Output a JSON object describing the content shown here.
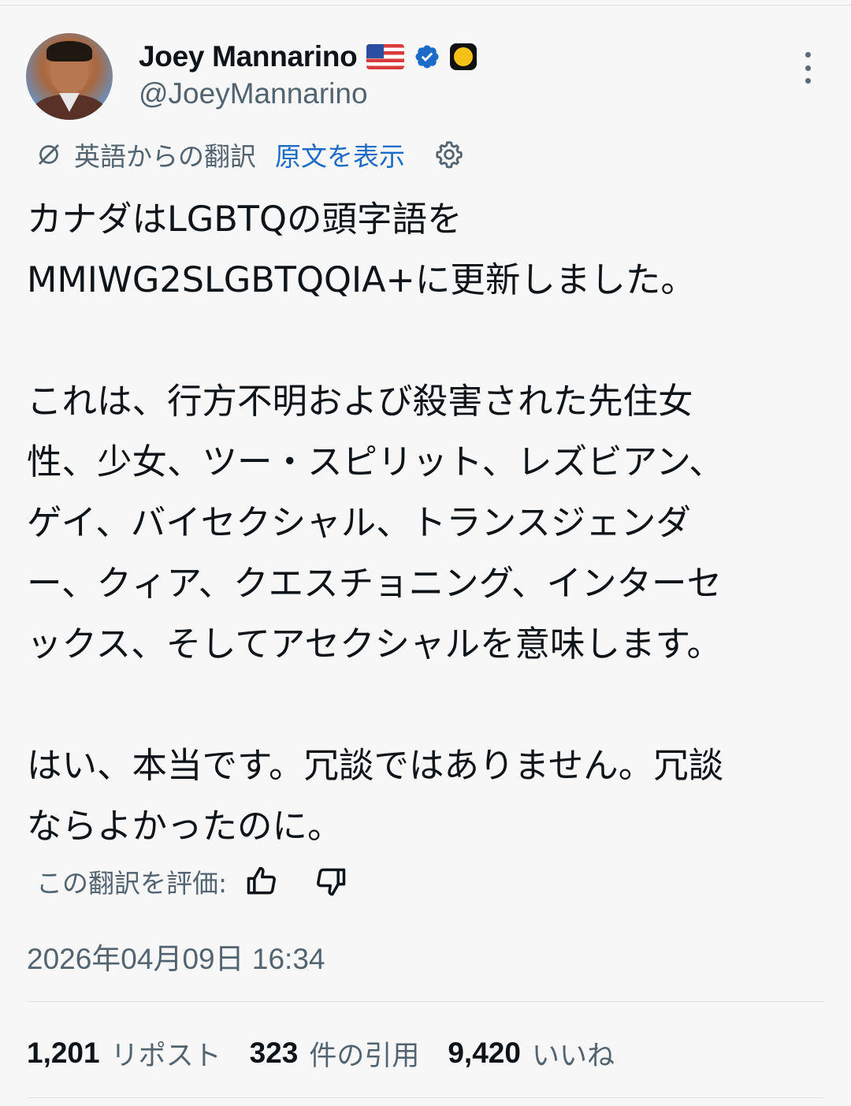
{
  "author": {
    "display_name": "Joey Mannarino",
    "handle": "@JoeyMannarino",
    "flag_icon": "us-flag-icon",
    "verified_icon": "verified-badge-icon",
    "affiliate_icon": "gold-badge-icon"
  },
  "translation": {
    "label": "英語からの翻訳",
    "show_original": "原文を表示"
  },
  "tweet": {
    "paragraph_1": "カナダはLGBTQの頭字語を\nMMIWG2SLGBTQQIA+に更新しました。",
    "paragraph_2": "これは、行方不明および殺害された先住女\n性、少女、ツー・スピリット、レズビアン、\nゲイ、バイセクシャル、トランスジェンダ\nー、クィア、クエスチョニング、インターセ\nックス、そしてアセクシャルを意味します。",
    "paragraph_3": "はい、本当です。冗談ではありません。冗談\nならよかったのに。"
  },
  "rate_translation": {
    "label": "この翻訳を評価:"
  },
  "timestamp": "2026年04月09日 16:34",
  "stats": {
    "reposts_count": "1,201",
    "reposts_label": "リポスト",
    "quotes_count": "323",
    "quotes_label": "件の引用",
    "likes_count": "9,420",
    "likes_label": "いいね"
  },
  "colors": {
    "background": "#f7f7f7",
    "link": "#1d6bc8",
    "secondary_text": "#536471",
    "verified": "#1d6bc8",
    "gold_badge": "#f5c118"
  }
}
